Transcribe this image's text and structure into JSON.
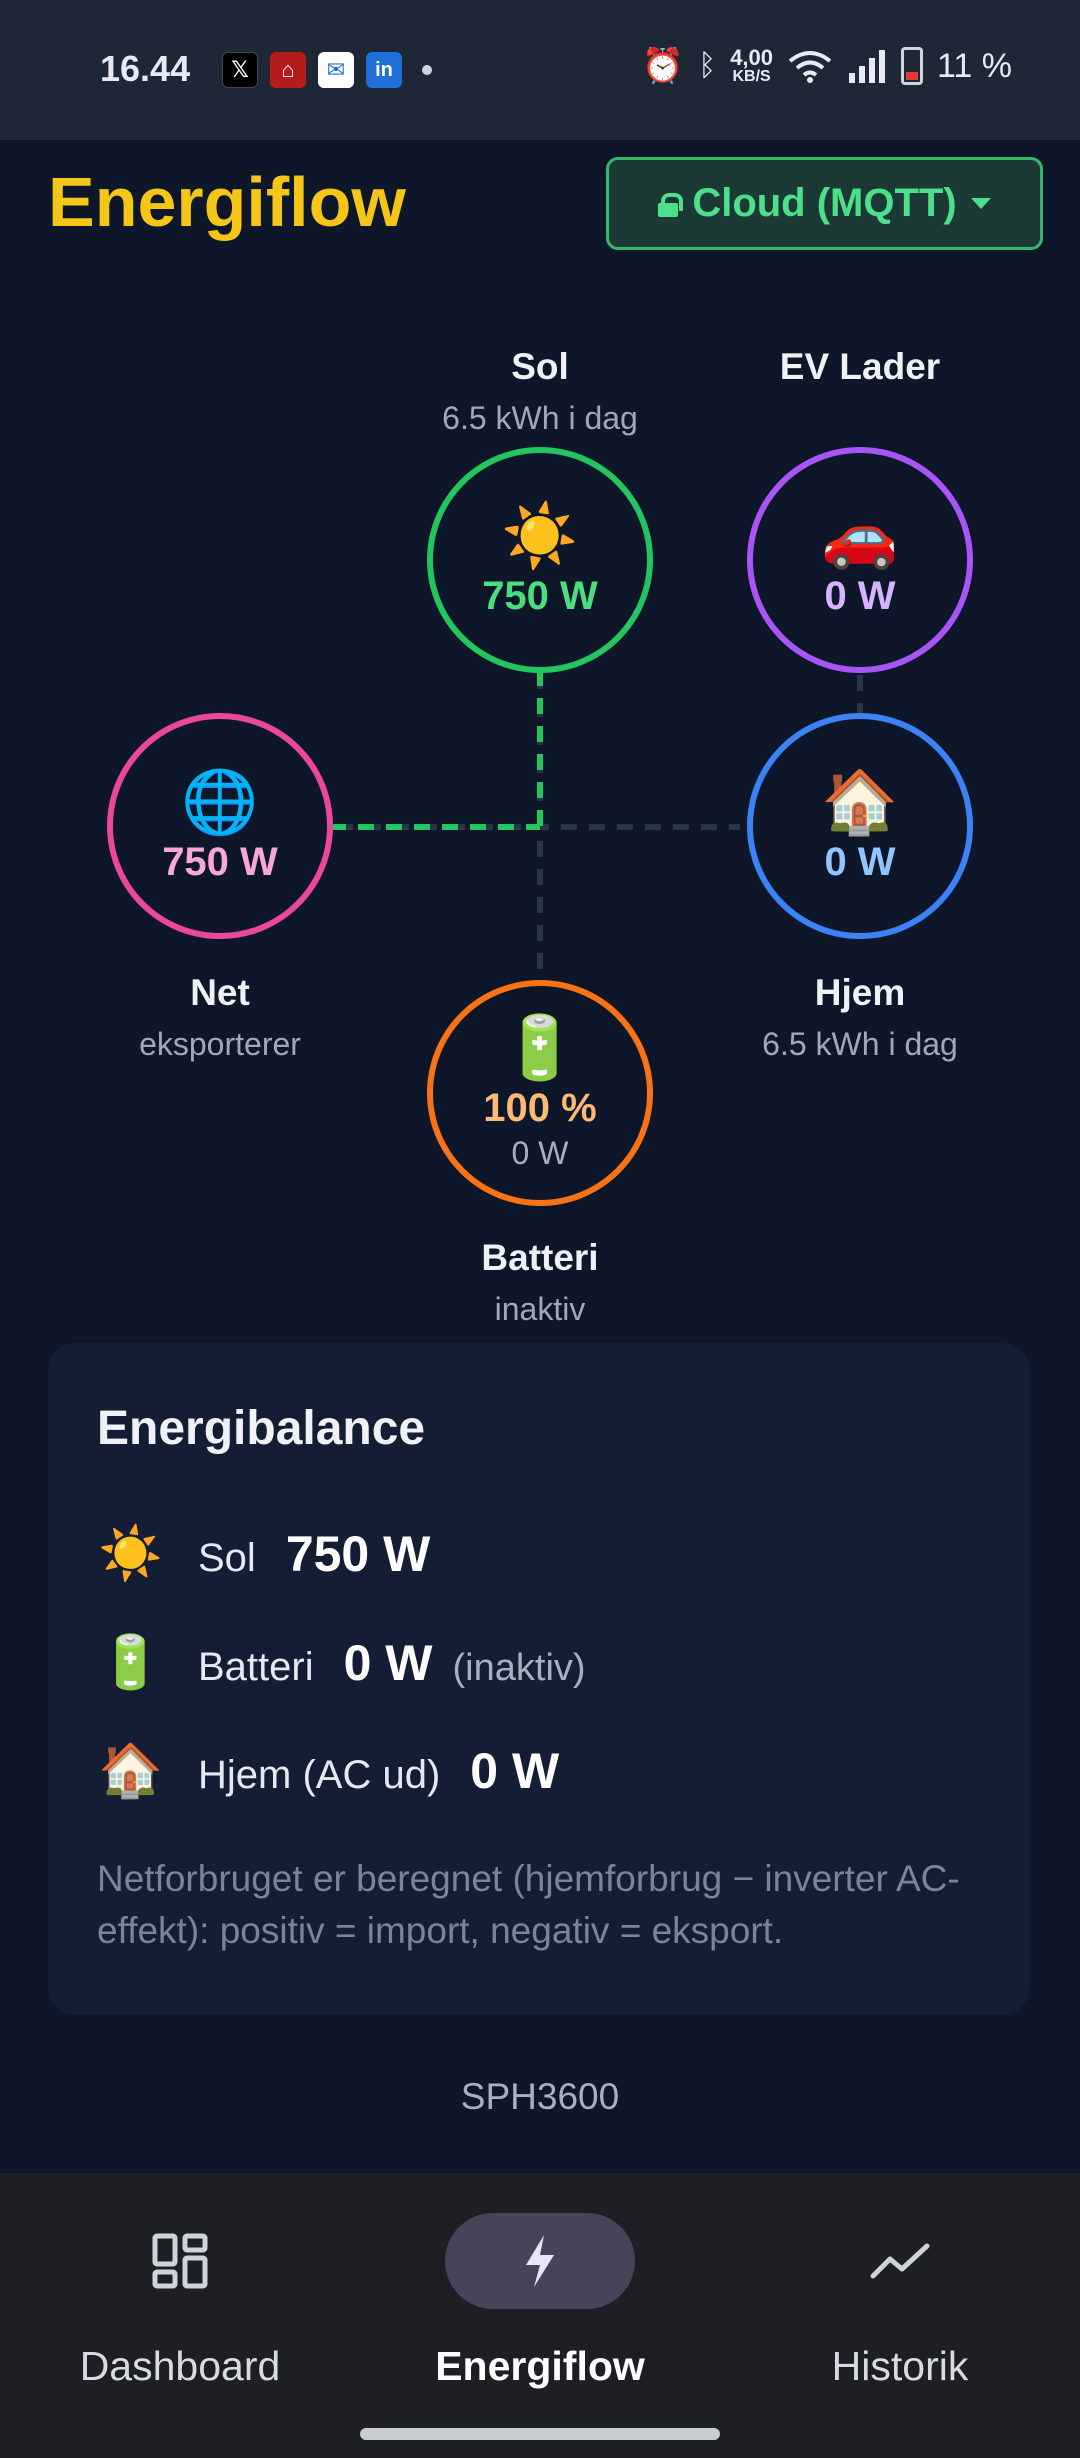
{
  "status_bar": {
    "time": "16.44",
    "speed_value": "4,00",
    "speed_unit": "KB/S",
    "battery_percent": "11 %"
  },
  "header": {
    "title": "Energiflow",
    "mode_label": "Cloud (MQTT)"
  },
  "flow": {
    "solar": {
      "label": "Sol",
      "sub": "6.5 kWh i dag",
      "value": "750 W",
      "icon": "sun-icon",
      "emoji": "☀️",
      "color": "#22c55e",
      "value_color": "#4ade80"
    },
    "ev": {
      "label": "EV Lader",
      "value": "0 W",
      "icon": "car-icon",
      "emoji": "🚗",
      "color": "#a855f7",
      "value_color": "#d8b4fe"
    },
    "grid": {
      "label": "Net",
      "sub": "eksporterer",
      "value": "750 W",
      "icon": "globe-icon",
      "emoji": "🌐",
      "color": "#ec4899",
      "value_color": "#f9a8d4"
    },
    "home": {
      "label": "Hjem",
      "sub": "6.5 kWh i dag",
      "value": "0 W",
      "icon": "house-icon",
      "emoji": "🏠",
      "color": "#3b82f6",
      "value_color": "#93c5fd"
    },
    "battery": {
      "label": "Batteri",
      "sub": "inaktiv",
      "value": "100 %",
      "power": "0 W",
      "icon": "battery-icon",
      "emoji": "🔋",
      "color": "#f97316",
      "value_color": "#fdba74"
    }
  },
  "balance": {
    "title": "Energibalance",
    "rows": [
      {
        "icon": "sun-icon",
        "emoji": "☀️",
        "label": "Sol",
        "value": "750 W",
        "note": ""
      },
      {
        "icon": "battery-icon",
        "emoji": "🔋",
        "label": "Batteri",
        "value": "0 W",
        "note": "(inaktiv)"
      },
      {
        "icon": "house-icon",
        "emoji": "🏠",
        "label": "Hjem (AC ud)",
        "value": "0 W",
        "note": ""
      }
    ],
    "note": "Netforbruget er beregnet (hjemforbrug − inverter AC-effekt): positiv = import, negativ = eksport."
  },
  "device_model": "SPH3600",
  "nav": {
    "items": [
      {
        "label": "Dashboard",
        "icon": "dashboard-icon",
        "active": false
      },
      {
        "label": "Energiflow",
        "icon": "bolt-icon",
        "active": true
      },
      {
        "label": "Historik",
        "icon": "chart-line-icon",
        "active": false
      }
    ]
  }
}
